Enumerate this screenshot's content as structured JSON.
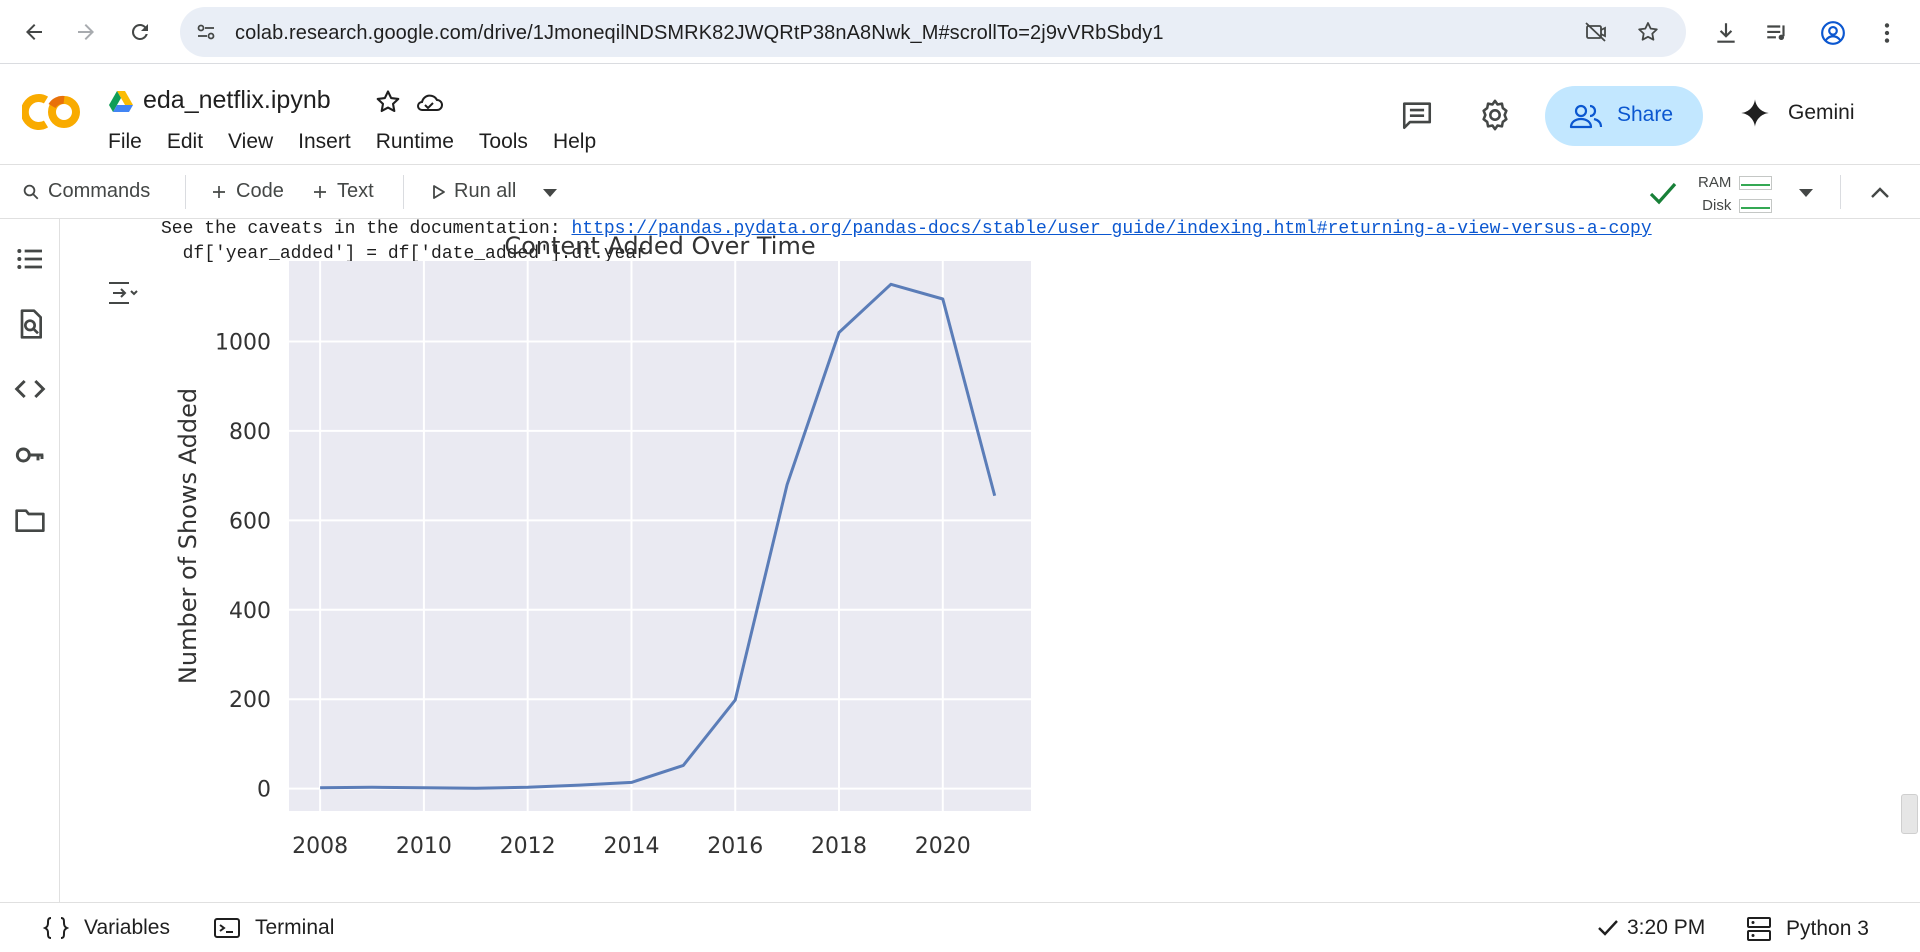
{
  "browser": {
    "url": "colab.research.google.com/drive/1JmoneqilNDSMRK82JWQRtP38nA8Nwk_M#scrollTo=2j9vVRbSbdy1"
  },
  "header": {
    "notebook_title": "eda_netflix.ipynb",
    "menu": [
      "File",
      "Edit",
      "View",
      "Insert",
      "Runtime",
      "Tools",
      "Help"
    ],
    "share_label": "Share",
    "gemini_label": "Gemini"
  },
  "toolbar": {
    "commands_label": "Commands",
    "code_label": "Code",
    "text_label": "Text",
    "run_all_label": "Run all",
    "ram_label": "RAM",
    "disk_label": "Disk"
  },
  "output": {
    "warning_prefix": "See the caveats in the documentation: ",
    "warning_link": "https://pandas.pydata.org/pandas-docs/stable/user_guide/indexing.html#returning-a-view-versus-a-copy",
    "code_echo": "  df['year_added'] = df['date_added'].dt.year"
  },
  "chart_data": {
    "type": "line",
    "title": "Content Added Over Time",
    "xlabel": "",
    "ylabel": "Number of Shows Added",
    "x": [
      2008,
      2009,
      2010,
      2011,
      2012,
      2013,
      2014,
      2015,
      2016,
      2017,
      2018,
      2019,
      2020,
      2021
    ],
    "values": [
      2,
      3,
      2,
      1,
      3,
      8,
      14,
      52,
      198,
      680,
      1020,
      1128,
      1095,
      655
    ],
    "xlim": [
      2007.4,
      2021.7
    ],
    "ylim": [
      -50,
      1180
    ],
    "xticks": [
      2008,
      2010,
      2012,
      2014,
      2016,
      2018,
      2020
    ],
    "yticks": [
      0,
      200,
      400,
      600,
      800,
      1000
    ],
    "grid": true,
    "line_color": "#5b7db8",
    "background_color": "#eaeaf2"
  },
  "status": {
    "variables_label": "Variables",
    "terminal_label": "Terminal",
    "time": "3:20 PM",
    "runtime_label": "Python 3"
  },
  "colors": {
    "share_bg": "#c2e7ff",
    "share_text": "#0b57d0",
    "link": "#0b57d0",
    "check": "#188038"
  }
}
